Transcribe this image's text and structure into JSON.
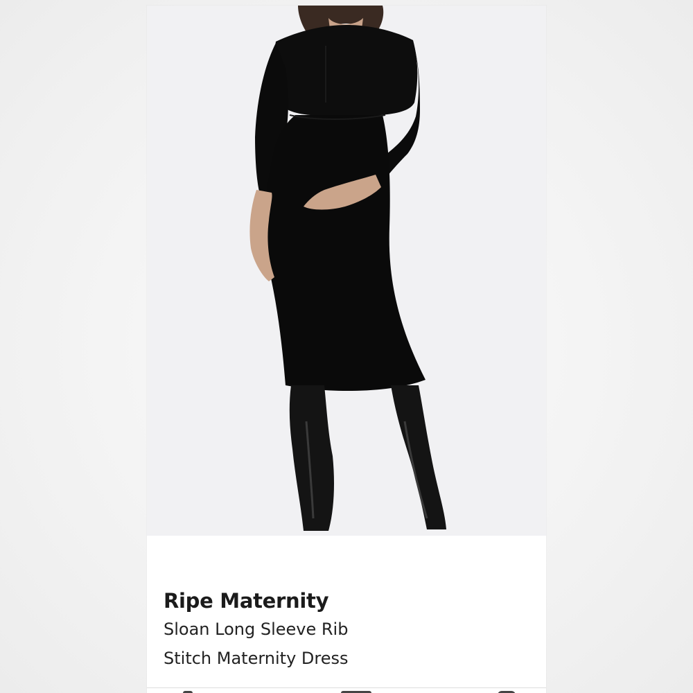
{
  "product": {
    "brand": "Ripe Maternity",
    "title_line1": "Sloan Long Sleeve Rib",
    "title_line2": "Stitch Maternity Dress"
  },
  "image": {
    "subject": "product-photo",
    "icon": "photo-icon"
  },
  "colors": {
    "card_background": "#ffffff",
    "photo_background": "#f1f1f3",
    "dress": "#0b0b0b",
    "boots": "#141414",
    "text": "#1b1b1b"
  }
}
